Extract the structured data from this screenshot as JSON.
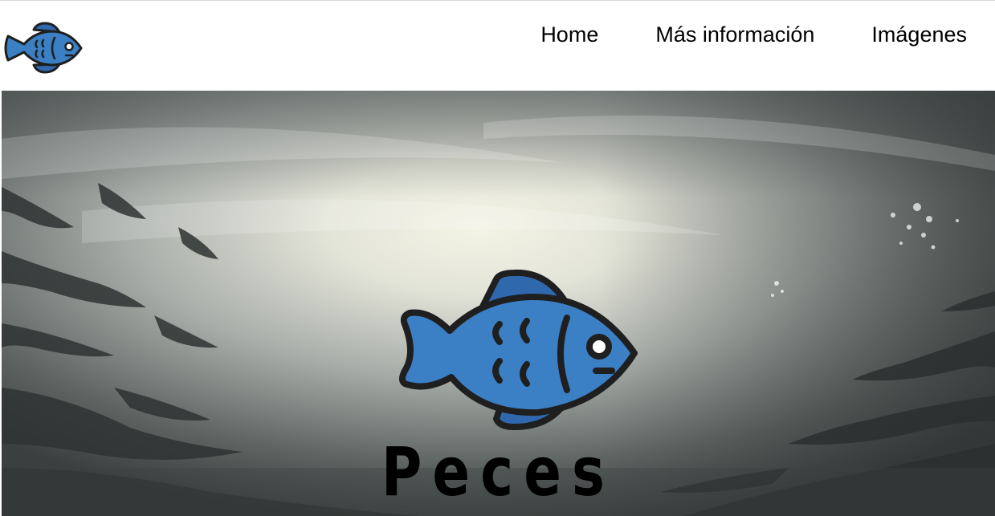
{
  "nav": {
    "logo_icon": "fish-icon",
    "items": [
      {
        "label": "Home"
      },
      {
        "label": "Más información"
      },
      {
        "label": "Imágenes"
      }
    ]
  },
  "hero": {
    "background": "underwater-water-surface-image",
    "icon": "fish-icon",
    "title": "Peces"
  },
  "colors": {
    "fish_blue": "#3b7fc4",
    "fin_blue": "#2f68ad",
    "outline": "#1f1f1f"
  }
}
